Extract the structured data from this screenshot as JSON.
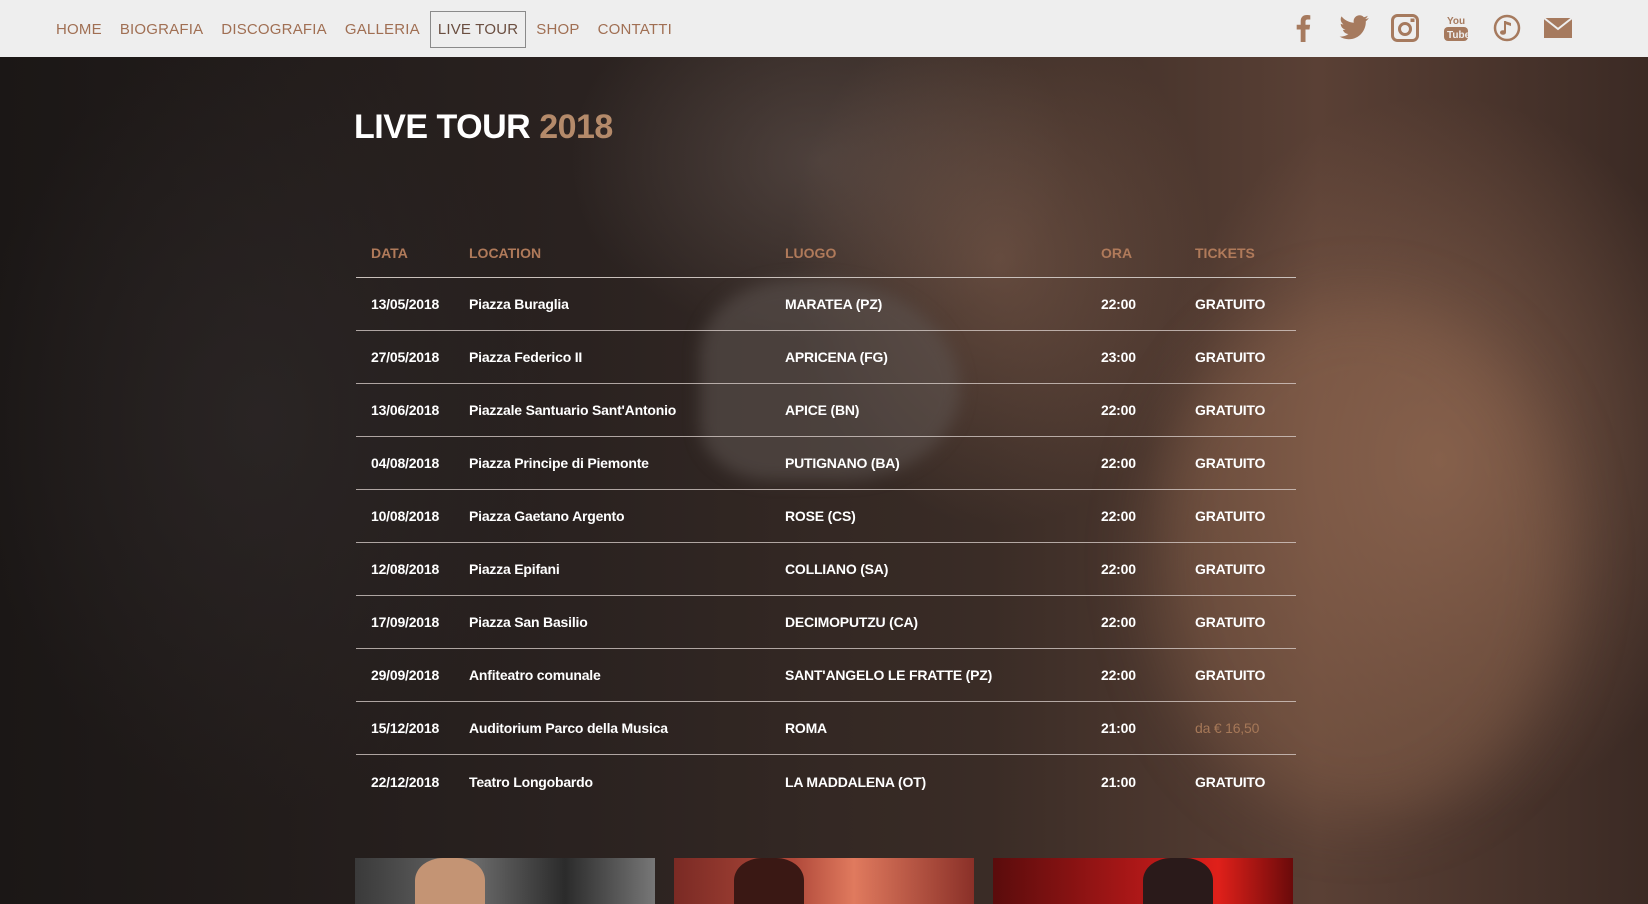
{
  "nav": {
    "items": [
      {
        "label": "HOME"
      },
      {
        "label": "BIOGRAFIA"
      },
      {
        "label": "DISCOGRAFIA"
      },
      {
        "label": "GALLERIA"
      },
      {
        "label": "LIVE TOUR",
        "active": true
      },
      {
        "label": "SHOP"
      },
      {
        "label": "CONTATTI"
      }
    ],
    "social": [
      "facebook-icon",
      "twitter-icon",
      "instagram-icon",
      "youtube-icon",
      "music-icon",
      "mail-icon"
    ]
  },
  "page": {
    "title": "LIVE TOUR",
    "year": "2018"
  },
  "table": {
    "headers": {
      "date": "DATA",
      "location": "LOCATION",
      "luogo": "LUOGO",
      "ora": "ORA",
      "tickets": "TICKETS"
    },
    "rows": [
      {
        "date": "13/05/2018",
        "location": "Piazza Buraglia",
        "luogo": "MARATEA (PZ)",
        "ora": "22:00",
        "tickets": "GRATUITO"
      },
      {
        "date": "27/05/2018",
        "location": "Piazza Federico II",
        "luogo": "APRICENA (FG)",
        "ora": "23:00",
        "tickets": "GRATUITO"
      },
      {
        "date": "13/06/2018",
        "location": "Piazzale Santuario Sant'Antonio",
        "luogo": "APICE (BN)",
        "ora": "22:00",
        "tickets": "GRATUITO"
      },
      {
        "date": "04/08/2018",
        "location": "Piazza Principe di Piemonte",
        "luogo": "PUTIGNANO (BA)",
        "ora": "22:00",
        "tickets": "GRATUITO"
      },
      {
        "date": "10/08/2018",
        "location": "Piazza Gaetano Argento",
        "luogo": "ROSE (CS)",
        "ora": "22:00",
        "tickets": "GRATUITO"
      },
      {
        "date": "12/08/2018",
        "location": "Piazza Epifani",
        "luogo": "COLLIANO (SA)",
        "ora": "22:00",
        "tickets": "GRATUITO"
      },
      {
        "date": "17/09/2018",
        "location": "Piazza San Basilio",
        "luogo": "DECIMOPUTZU (CA)",
        "ora": "22:00",
        "tickets": "GRATUITO"
      },
      {
        "date": "29/09/2018",
        "location": "Anfiteatro comunale",
        "luogo": "SANT'ANGELO LE FRATTE (PZ)",
        "ora": "22:00",
        "tickets": "GRATUITO"
      },
      {
        "date": "15/12/2018",
        "location": "Auditorium Parco della Musica",
        "luogo": "ROMA",
        "ora": "21:00",
        "tickets": "da € 16,50",
        "ticket_link": true
      },
      {
        "date": "22/12/2018",
        "location": "Teatro Longobardo",
        "luogo": "LA MADDALENA (OT)",
        "ora": "21:00",
        "tickets": "GRATUITO"
      }
    ]
  },
  "colors": {
    "accent": "#b07a5a",
    "nav_bg": "#eeeeee",
    "nav_text": "#a06f53",
    "text": "#ffffff"
  }
}
